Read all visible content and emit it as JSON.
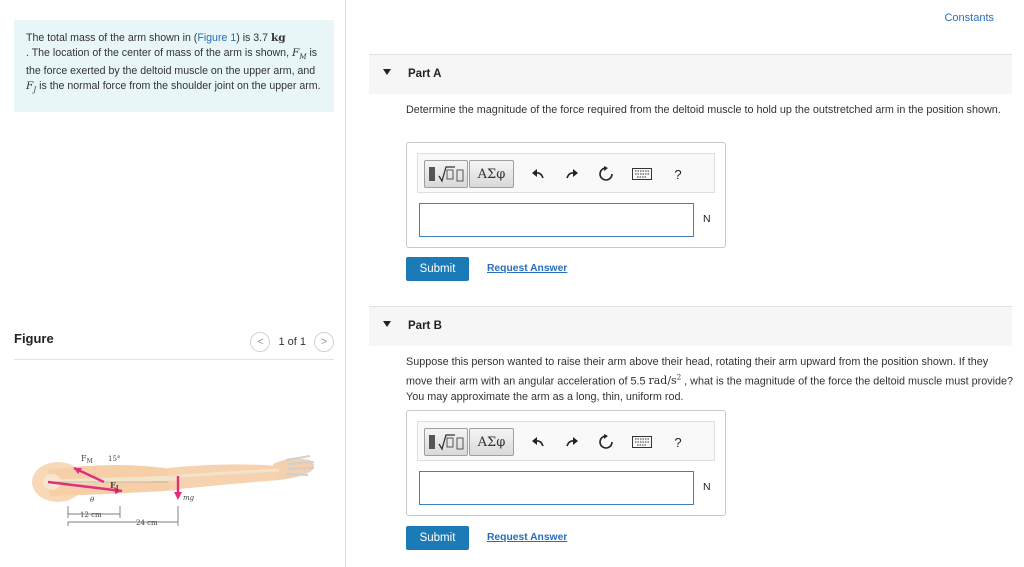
{
  "intro": {
    "p1": "The total mass of the arm shown in (",
    "figure_link": "Figure 1",
    "p2": ") is 3.7 ",
    "mass_unit": "kg",
    "p3": ". The location of the center of mass of the arm is shown,",
    "fm": "F",
    "fm_sub": "M",
    "p4": " is the force exerted by the deltoid muscle on the upper arm, and ",
    "fj": "F",
    "fj_sub": "J",
    "p5": " is the normal force from the shoulder joint on the upper arm."
  },
  "figure_panel": {
    "title": "Figure",
    "pager_text": "1 of 1",
    "prev_glyph": "<",
    "next_glyph": ">",
    "labels": {
      "fm": "F",
      "fm_sub": "M",
      "angle": "15°",
      "fj": "F",
      "fj_sub": "J",
      "theta": "θ",
      "mg": "mg",
      "dist1": "12 cm",
      "dist2": "24 cm"
    }
  },
  "header": {
    "constants": "Constants"
  },
  "partA": {
    "label": "Part A",
    "question": "Determine the magnitude of the force required from the deltoid muscle to hold up the outstretched arm in the position shown.",
    "unit": "N",
    "submit": "Submit",
    "request": "Request Answer"
  },
  "partB": {
    "label": "Part B",
    "q1": "Suppose this person wanted to raise their arm above their head, rotating their arm upward from the position shown. If they move their arm with an angular acceleration of 5.5 ",
    "accel_unit": "rad/s",
    "accel_exp": "2",
    "q2": " , what is the magnitude of the force the deltoid muscle must provide? You may approximate the arm as a long, thin, uniform rod.",
    "unit": "N",
    "submit": "Submit",
    "request": "Request Answer"
  },
  "toolbar": {
    "greek": "ΑΣφ",
    "help": "?"
  },
  "colors": {
    "accent": "#1c7ab6",
    "link": "#2a6ebb",
    "intro_bg": "#e8f6f7",
    "force_arrow": "#e0307a"
  }
}
